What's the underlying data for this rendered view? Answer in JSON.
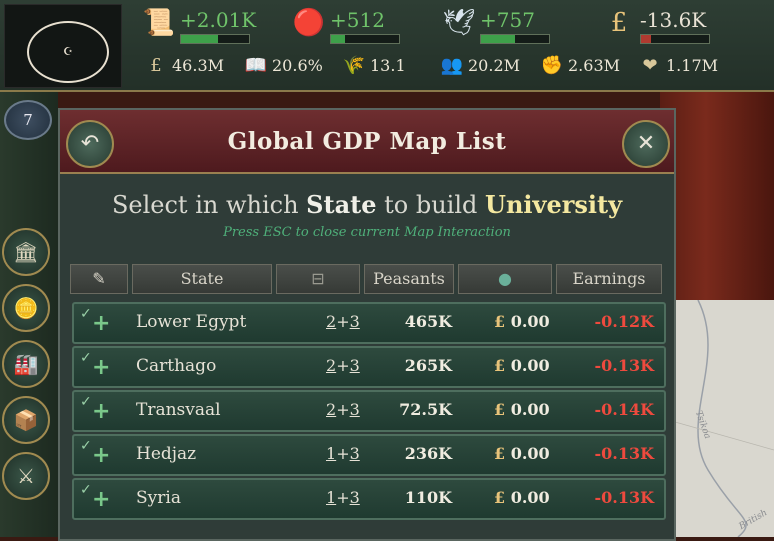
{
  "colors": {
    "positive": "#6fc36a",
    "negative": "#ee4a3e",
    "highlight": "#f4e8a0",
    "hint": "#4fb07a",
    "panel_header": "#6e2e30"
  },
  "resources": [
    {
      "icon": "scroll-quill-icon",
      "glyph": "📜",
      "value": "+2.01K",
      "color": "#6fc36a",
      "bar_fill": 0.55
    },
    {
      "icon": "seal-stamp-icon",
      "glyph": "🔴",
      "value": "+512",
      "color": "#6fc36a",
      "bar_fill": 0.2
    },
    {
      "icon": "dove-icon",
      "glyph": "🕊",
      "value": "+757",
      "color": "#6fc36a",
      "bar_fill": 0.5
    },
    {
      "icon": "pound-icon",
      "glyph": "£",
      "value": "-13.6K",
      "color": "#e8e2d4",
      "bar_fill": 0.15
    }
  ],
  "stats": [
    {
      "icon": "gdp-coin-icon",
      "glyph": "£",
      "value": "46.3M"
    },
    {
      "icon": "literacy-book-icon",
      "glyph": "📖",
      "value": "20.6%"
    },
    {
      "icon": "wheat-icon",
      "glyph": "🌾",
      "value": "13.1"
    },
    {
      "icon": "population-icon",
      "glyph": "👥",
      "value": "20.2M"
    },
    {
      "icon": "fist-icon",
      "glyph": "✊",
      "value": "2.63M"
    },
    {
      "icon": "heart-icon",
      "glyph": "❤",
      "value": "1.17M"
    }
  ],
  "rank": "7",
  "sidebar": [
    {
      "icon": "government-building-icon",
      "glyph": "🏛"
    },
    {
      "icon": "coins-icon",
      "glyph": "🪙"
    },
    {
      "icon": "factory-icon",
      "glyph": "🏭"
    },
    {
      "icon": "crate-icon",
      "glyph": "📦"
    },
    {
      "icon": "crossed-swords-icon",
      "glyph": "⚔"
    }
  ],
  "panel": {
    "title": "Global GDP Map List",
    "prompt_pre": "Select in which ",
    "prompt_state": "State",
    "prompt_mid": " to build ",
    "prompt_building": "University",
    "hint": "Press ESC to close current Map Interaction",
    "back_glyph": "↶",
    "close_glyph": "✕"
  },
  "table": {
    "headers": [
      "",
      "State",
      "",
      "Peasants",
      "",
      "Earnings"
    ],
    "rows": [
      {
        "state": "Lower Egypt",
        "lvl_a": "2",
        "lvl_b": "3",
        "peasants": "465K",
        "money": "0.00",
        "earnings": "-0.12K"
      },
      {
        "state": "Carthago",
        "lvl_a": "2",
        "lvl_b": "3",
        "peasants": "265K",
        "money": "0.00",
        "earnings": "-0.13K"
      },
      {
        "state": "Transvaal",
        "lvl_a": "2",
        "lvl_b": "3",
        "peasants": "72.5K",
        "money": "0.00",
        "earnings": "-0.14K"
      },
      {
        "state": "Hedjaz",
        "lvl_a": "1",
        "lvl_b": "3",
        "peasants": "236K",
        "money": "0.00",
        "earnings": "-0.13K"
      },
      {
        "state": "Syria",
        "lvl_a": "1",
        "lvl_b": "3",
        "peasants": "110K",
        "money": "0.00",
        "earnings": "-0.13K"
      }
    ]
  },
  "map_labels": {
    "a": "Tsikoa",
    "b": "British"
  }
}
